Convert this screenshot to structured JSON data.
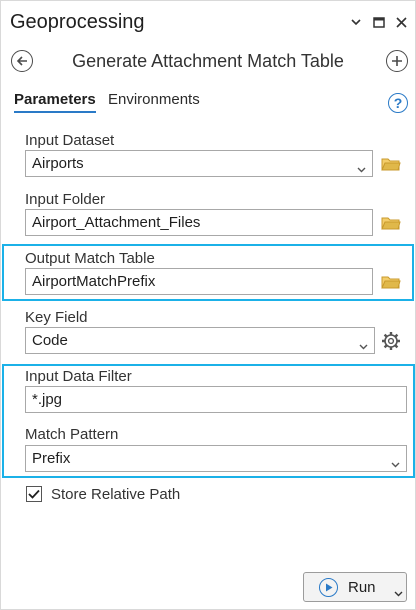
{
  "pane": {
    "title": "Geoprocessing",
    "tool_title": "Generate Attachment Match Table"
  },
  "tabs": [
    {
      "label": "Parameters",
      "active": true
    },
    {
      "label": "Environments",
      "active": false
    }
  ],
  "help_label": "?",
  "params": {
    "input_dataset": {
      "label": "Input Dataset",
      "value": "Airports"
    },
    "input_folder": {
      "label": "Input Folder",
      "value": "Airport_Attachment_Files"
    },
    "output_match_table": {
      "label": "Output Match Table",
      "value": "AirportMatchPrefix"
    },
    "key_field": {
      "label": "Key Field",
      "value": "Code"
    },
    "input_data_filter": {
      "label": "Input Data Filter",
      "value": "*.jpg"
    },
    "match_pattern": {
      "label": "Match Pattern",
      "value": "Prefix"
    },
    "store_relative_path": {
      "label": "Store Relative Path",
      "checked": true
    }
  },
  "run_button": {
    "label": "Run"
  },
  "colors": {
    "accent": "#2a7ac7",
    "highlight": "#1bb1e8",
    "folder": "#e0b84a"
  },
  "icons": [
    "chevron-down-icon",
    "maximize-icon",
    "close-icon",
    "back-icon",
    "add-icon",
    "help-icon",
    "folder-icon",
    "gear-icon",
    "checkmark-icon",
    "play-icon"
  ]
}
